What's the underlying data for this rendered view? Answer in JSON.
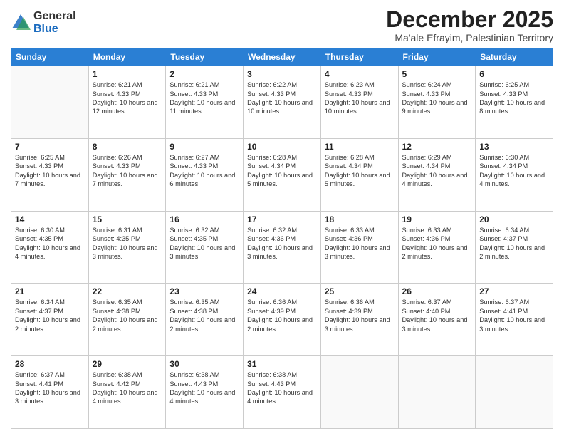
{
  "logo": {
    "general": "General",
    "blue": "Blue"
  },
  "header": {
    "month": "December 2025",
    "location": "Ma'ale Efrayim, Palestinian Territory"
  },
  "weekdays": [
    "Sunday",
    "Monday",
    "Tuesday",
    "Wednesday",
    "Thursday",
    "Friday",
    "Saturday"
  ],
  "weeks": [
    [
      {
        "day": "",
        "sunrise": "",
        "sunset": "",
        "daylight": ""
      },
      {
        "day": "1",
        "sunrise": "Sunrise: 6:21 AM",
        "sunset": "Sunset: 4:33 PM",
        "daylight": "Daylight: 10 hours and 12 minutes."
      },
      {
        "day": "2",
        "sunrise": "Sunrise: 6:21 AM",
        "sunset": "Sunset: 4:33 PM",
        "daylight": "Daylight: 10 hours and 11 minutes."
      },
      {
        "day": "3",
        "sunrise": "Sunrise: 6:22 AM",
        "sunset": "Sunset: 4:33 PM",
        "daylight": "Daylight: 10 hours and 10 minutes."
      },
      {
        "day": "4",
        "sunrise": "Sunrise: 6:23 AM",
        "sunset": "Sunset: 4:33 PM",
        "daylight": "Daylight: 10 hours and 10 minutes."
      },
      {
        "day": "5",
        "sunrise": "Sunrise: 6:24 AM",
        "sunset": "Sunset: 4:33 PM",
        "daylight": "Daylight: 10 hours and 9 minutes."
      },
      {
        "day": "6",
        "sunrise": "Sunrise: 6:25 AM",
        "sunset": "Sunset: 4:33 PM",
        "daylight": "Daylight: 10 hours and 8 minutes."
      }
    ],
    [
      {
        "day": "7",
        "sunrise": "Sunrise: 6:25 AM",
        "sunset": "Sunset: 4:33 PM",
        "daylight": "Daylight: 10 hours and 7 minutes."
      },
      {
        "day": "8",
        "sunrise": "Sunrise: 6:26 AM",
        "sunset": "Sunset: 4:33 PM",
        "daylight": "Daylight: 10 hours and 7 minutes."
      },
      {
        "day": "9",
        "sunrise": "Sunrise: 6:27 AM",
        "sunset": "Sunset: 4:33 PM",
        "daylight": "Daylight: 10 hours and 6 minutes."
      },
      {
        "day": "10",
        "sunrise": "Sunrise: 6:28 AM",
        "sunset": "Sunset: 4:34 PM",
        "daylight": "Daylight: 10 hours and 5 minutes."
      },
      {
        "day": "11",
        "sunrise": "Sunrise: 6:28 AM",
        "sunset": "Sunset: 4:34 PM",
        "daylight": "Daylight: 10 hours and 5 minutes."
      },
      {
        "day": "12",
        "sunrise": "Sunrise: 6:29 AM",
        "sunset": "Sunset: 4:34 PM",
        "daylight": "Daylight: 10 hours and 4 minutes."
      },
      {
        "day": "13",
        "sunrise": "Sunrise: 6:30 AM",
        "sunset": "Sunset: 4:34 PM",
        "daylight": "Daylight: 10 hours and 4 minutes."
      }
    ],
    [
      {
        "day": "14",
        "sunrise": "Sunrise: 6:30 AM",
        "sunset": "Sunset: 4:35 PM",
        "daylight": "Daylight: 10 hours and 4 minutes."
      },
      {
        "day": "15",
        "sunrise": "Sunrise: 6:31 AM",
        "sunset": "Sunset: 4:35 PM",
        "daylight": "Daylight: 10 hours and 3 minutes."
      },
      {
        "day": "16",
        "sunrise": "Sunrise: 6:32 AM",
        "sunset": "Sunset: 4:35 PM",
        "daylight": "Daylight: 10 hours and 3 minutes."
      },
      {
        "day": "17",
        "sunrise": "Sunrise: 6:32 AM",
        "sunset": "Sunset: 4:36 PM",
        "daylight": "Daylight: 10 hours and 3 minutes."
      },
      {
        "day": "18",
        "sunrise": "Sunrise: 6:33 AM",
        "sunset": "Sunset: 4:36 PM",
        "daylight": "Daylight: 10 hours and 3 minutes."
      },
      {
        "day": "19",
        "sunrise": "Sunrise: 6:33 AM",
        "sunset": "Sunset: 4:36 PM",
        "daylight": "Daylight: 10 hours and 2 minutes."
      },
      {
        "day": "20",
        "sunrise": "Sunrise: 6:34 AM",
        "sunset": "Sunset: 4:37 PM",
        "daylight": "Daylight: 10 hours and 2 minutes."
      }
    ],
    [
      {
        "day": "21",
        "sunrise": "Sunrise: 6:34 AM",
        "sunset": "Sunset: 4:37 PM",
        "daylight": "Daylight: 10 hours and 2 minutes."
      },
      {
        "day": "22",
        "sunrise": "Sunrise: 6:35 AM",
        "sunset": "Sunset: 4:38 PM",
        "daylight": "Daylight: 10 hours and 2 minutes."
      },
      {
        "day": "23",
        "sunrise": "Sunrise: 6:35 AM",
        "sunset": "Sunset: 4:38 PM",
        "daylight": "Daylight: 10 hours and 2 minutes."
      },
      {
        "day": "24",
        "sunrise": "Sunrise: 6:36 AM",
        "sunset": "Sunset: 4:39 PM",
        "daylight": "Daylight: 10 hours and 2 minutes."
      },
      {
        "day": "25",
        "sunrise": "Sunrise: 6:36 AM",
        "sunset": "Sunset: 4:39 PM",
        "daylight": "Daylight: 10 hours and 3 minutes."
      },
      {
        "day": "26",
        "sunrise": "Sunrise: 6:37 AM",
        "sunset": "Sunset: 4:40 PM",
        "daylight": "Daylight: 10 hours and 3 minutes."
      },
      {
        "day": "27",
        "sunrise": "Sunrise: 6:37 AM",
        "sunset": "Sunset: 4:41 PM",
        "daylight": "Daylight: 10 hours and 3 minutes."
      }
    ],
    [
      {
        "day": "28",
        "sunrise": "Sunrise: 6:37 AM",
        "sunset": "Sunset: 4:41 PM",
        "daylight": "Daylight: 10 hours and 3 minutes."
      },
      {
        "day": "29",
        "sunrise": "Sunrise: 6:38 AM",
        "sunset": "Sunset: 4:42 PM",
        "daylight": "Daylight: 10 hours and 4 minutes."
      },
      {
        "day": "30",
        "sunrise": "Sunrise: 6:38 AM",
        "sunset": "Sunset: 4:43 PM",
        "daylight": "Daylight: 10 hours and 4 minutes."
      },
      {
        "day": "31",
        "sunrise": "Sunrise: 6:38 AM",
        "sunset": "Sunset: 4:43 PM",
        "daylight": "Daylight: 10 hours and 4 minutes."
      },
      {
        "day": "",
        "sunrise": "",
        "sunset": "",
        "daylight": ""
      },
      {
        "day": "",
        "sunrise": "",
        "sunset": "",
        "daylight": ""
      },
      {
        "day": "",
        "sunrise": "",
        "sunset": "",
        "daylight": ""
      }
    ]
  ]
}
